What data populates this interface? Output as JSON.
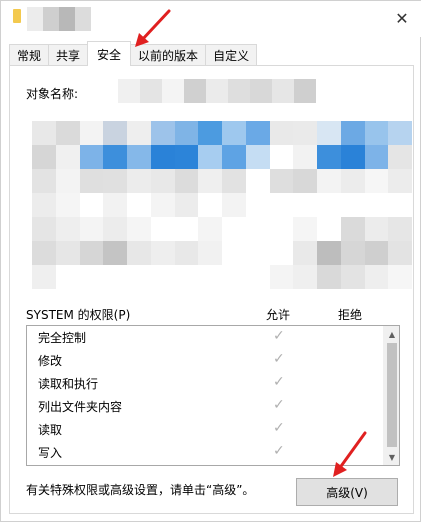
{
  "window": {
    "close_icon": "close-icon"
  },
  "tabs": [
    {
      "label": "常规"
    },
    {
      "label": "共享"
    },
    {
      "label": "安全",
      "active": true
    },
    {
      "label": "以前的版本"
    },
    {
      "label": "自定义"
    }
  ],
  "security": {
    "object_name_label": "对象名称:",
    "permissions_title": "SYSTEM 的权限(P)",
    "allow_header": "允许",
    "deny_header": "拒绝",
    "permissions": [
      {
        "name": "完全控制",
        "allow": true,
        "deny": false
      },
      {
        "name": "修改",
        "allow": true,
        "deny": false
      },
      {
        "name": "读取和执行",
        "allow": true,
        "deny": false
      },
      {
        "name": "列出文件夹内容",
        "allow": true,
        "deny": false
      },
      {
        "name": "读取",
        "allow": true,
        "deny": false
      },
      {
        "name": "写入",
        "allow": true,
        "deny": false
      }
    ],
    "footer_text": "有关特殊权限或高级设置，请单击“高级”。",
    "advanced_button": "高级(V)",
    "check_glyph": "✓"
  },
  "colors": {
    "annotation_arrow": "#e02020",
    "check": "#b0b0b0"
  }
}
